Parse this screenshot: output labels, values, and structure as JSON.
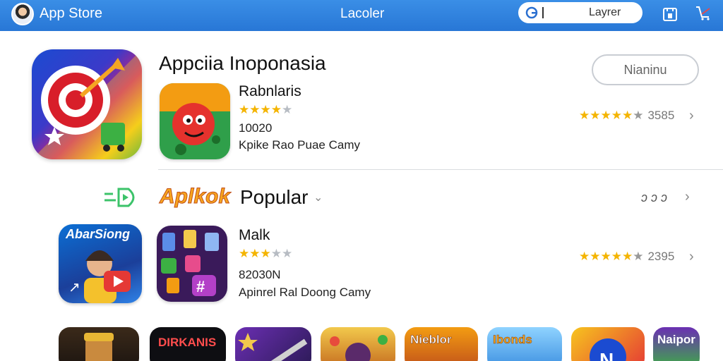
{
  "header": {
    "app_title": "App Store",
    "center_title": "Lacoler",
    "search_value": "Layrer",
    "icons": [
      "avatar",
      "g-icon",
      "bag-icon",
      "cart-icon"
    ]
  },
  "featured": {
    "title": "Appciia Inoponasia",
    "button_label": "Nianinu",
    "app": {
      "name": "Rabnlaris",
      "rating_stars": 4,
      "size": "10020",
      "category": "Kpike Rao Puae Camy",
      "right_rating_stars": 5,
      "right_count": "3585"
    }
  },
  "section": {
    "brand": "Aplkok",
    "title": "Popular",
    "more": "ɔ ɔ ɔ",
    "left_label": "AbarSiong"
  },
  "popular_app": {
    "name": "Malk",
    "rating_stars": 3,
    "size": "82030N",
    "category": "Apinrel Ral Doong Camy",
    "right_rating_stars": 5,
    "right_count": "2395"
  },
  "strip": {
    "labels": [
      "",
      "DIRKANIS",
      "",
      "",
      "Nieblor",
      "Ibonds",
      "",
      "Naipor"
    ]
  },
  "colors": {
    "header_blue": "#2f82de",
    "star": "#f4b400",
    "star_off": "#b7bcc3"
  }
}
